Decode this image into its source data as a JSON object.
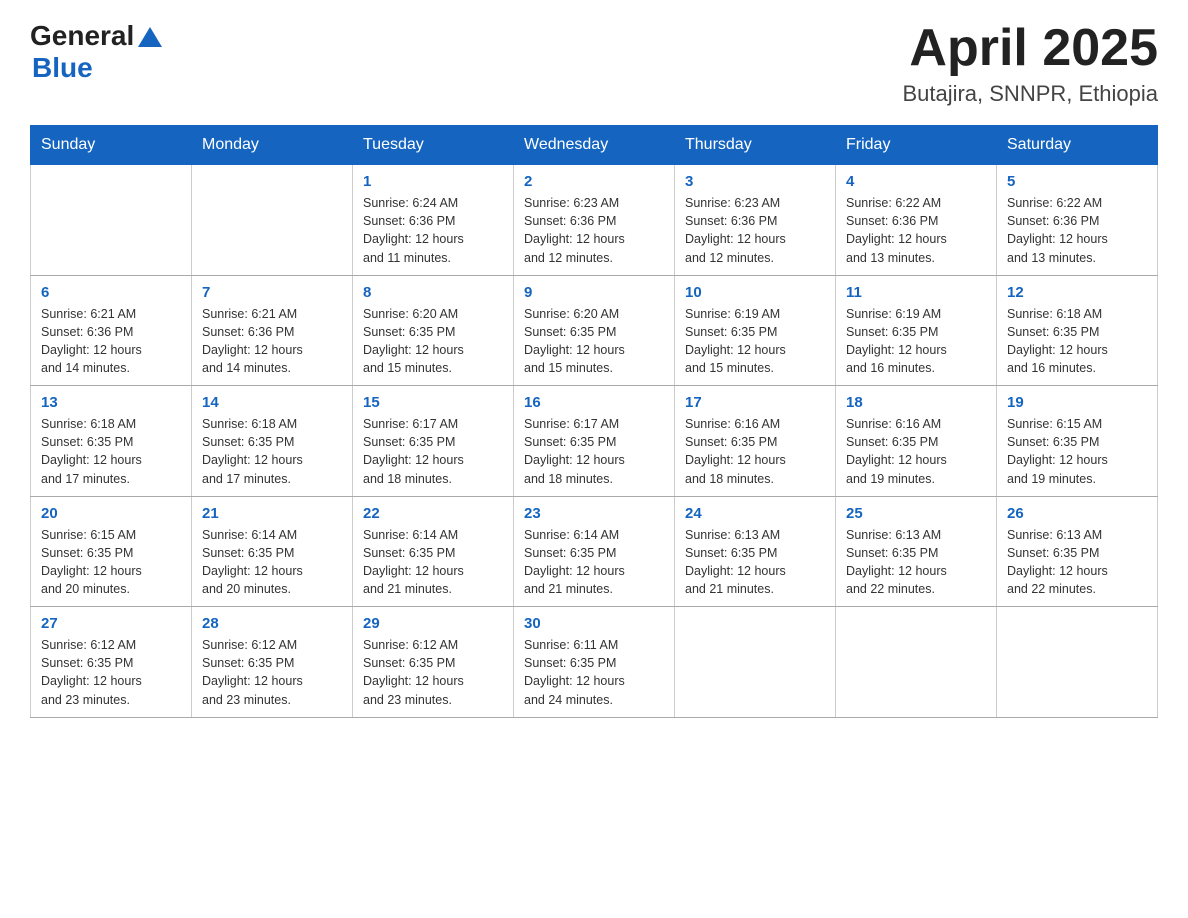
{
  "header": {
    "logo_general": "General",
    "logo_blue": "Blue",
    "month_title": "April 2025",
    "subtitle": "Butajira, SNNPR, Ethiopia"
  },
  "weekdays": [
    "Sunday",
    "Monday",
    "Tuesday",
    "Wednesday",
    "Thursday",
    "Friday",
    "Saturday"
  ],
  "weeks": [
    [
      {
        "day": "",
        "info": ""
      },
      {
        "day": "",
        "info": ""
      },
      {
        "day": "1",
        "info": "Sunrise: 6:24 AM\nSunset: 6:36 PM\nDaylight: 12 hours\nand 11 minutes."
      },
      {
        "day": "2",
        "info": "Sunrise: 6:23 AM\nSunset: 6:36 PM\nDaylight: 12 hours\nand 12 minutes."
      },
      {
        "day": "3",
        "info": "Sunrise: 6:23 AM\nSunset: 6:36 PM\nDaylight: 12 hours\nand 12 minutes."
      },
      {
        "day": "4",
        "info": "Sunrise: 6:22 AM\nSunset: 6:36 PM\nDaylight: 12 hours\nand 13 minutes."
      },
      {
        "day": "5",
        "info": "Sunrise: 6:22 AM\nSunset: 6:36 PM\nDaylight: 12 hours\nand 13 minutes."
      }
    ],
    [
      {
        "day": "6",
        "info": "Sunrise: 6:21 AM\nSunset: 6:36 PM\nDaylight: 12 hours\nand 14 minutes."
      },
      {
        "day": "7",
        "info": "Sunrise: 6:21 AM\nSunset: 6:36 PM\nDaylight: 12 hours\nand 14 minutes."
      },
      {
        "day": "8",
        "info": "Sunrise: 6:20 AM\nSunset: 6:35 PM\nDaylight: 12 hours\nand 15 minutes."
      },
      {
        "day": "9",
        "info": "Sunrise: 6:20 AM\nSunset: 6:35 PM\nDaylight: 12 hours\nand 15 minutes."
      },
      {
        "day": "10",
        "info": "Sunrise: 6:19 AM\nSunset: 6:35 PM\nDaylight: 12 hours\nand 15 minutes."
      },
      {
        "day": "11",
        "info": "Sunrise: 6:19 AM\nSunset: 6:35 PM\nDaylight: 12 hours\nand 16 minutes."
      },
      {
        "day": "12",
        "info": "Sunrise: 6:18 AM\nSunset: 6:35 PM\nDaylight: 12 hours\nand 16 minutes."
      }
    ],
    [
      {
        "day": "13",
        "info": "Sunrise: 6:18 AM\nSunset: 6:35 PM\nDaylight: 12 hours\nand 17 minutes."
      },
      {
        "day": "14",
        "info": "Sunrise: 6:18 AM\nSunset: 6:35 PM\nDaylight: 12 hours\nand 17 minutes."
      },
      {
        "day": "15",
        "info": "Sunrise: 6:17 AM\nSunset: 6:35 PM\nDaylight: 12 hours\nand 18 minutes."
      },
      {
        "day": "16",
        "info": "Sunrise: 6:17 AM\nSunset: 6:35 PM\nDaylight: 12 hours\nand 18 minutes."
      },
      {
        "day": "17",
        "info": "Sunrise: 6:16 AM\nSunset: 6:35 PM\nDaylight: 12 hours\nand 18 minutes."
      },
      {
        "day": "18",
        "info": "Sunrise: 6:16 AM\nSunset: 6:35 PM\nDaylight: 12 hours\nand 19 minutes."
      },
      {
        "day": "19",
        "info": "Sunrise: 6:15 AM\nSunset: 6:35 PM\nDaylight: 12 hours\nand 19 minutes."
      }
    ],
    [
      {
        "day": "20",
        "info": "Sunrise: 6:15 AM\nSunset: 6:35 PM\nDaylight: 12 hours\nand 20 minutes."
      },
      {
        "day": "21",
        "info": "Sunrise: 6:14 AM\nSunset: 6:35 PM\nDaylight: 12 hours\nand 20 minutes."
      },
      {
        "day": "22",
        "info": "Sunrise: 6:14 AM\nSunset: 6:35 PM\nDaylight: 12 hours\nand 21 minutes."
      },
      {
        "day": "23",
        "info": "Sunrise: 6:14 AM\nSunset: 6:35 PM\nDaylight: 12 hours\nand 21 minutes."
      },
      {
        "day": "24",
        "info": "Sunrise: 6:13 AM\nSunset: 6:35 PM\nDaylight: 12 hours\nand 21 minutes."
      },
      {
        "day": "25",
        "info": "Sunrise: 6:13 AM\nSunset: 6:35 PM\nDaylight: 12 hours\nand 22 minutes."
      },
      {
        "day": "26",
        "info": "Sunrise: 6:13 AM\nSunset: 6:35 PM\nDaylight: 12 hours\nand 22 minutes."
      }
    ],
    [
      {
        "day": "27",
        "info": "Sunrise: 6:12 AM\nSunset: 6:35 PM\nDaylight: 12 hours\nand 23 minutes."
      },
      {
        "day": "28",
        "info": "Sunrise: 6:12 AM\nSunset: 6:35 PM\nDaylight: 12 hours\nand 23 minutes."
      },
      {
        "day": "29",
        "info": "Sunrise: 6:12 AM\nSunset: 6:35 PM\nDaylight: 12 hours\nand 23 minutes."
      },
      {
        "day": "30",
        "info": "Sunrise: 6:11 AM\nSunset: 6:35 PM\nDaylight: 12 hours\nand 24 minutes."
      },
      {
        "day": "",
        "info": ""
      },
      {
        "day": "",
        "info": ""
      },
      {
        "day": "",
        "info": ""
      }
    ]
  ]
}
